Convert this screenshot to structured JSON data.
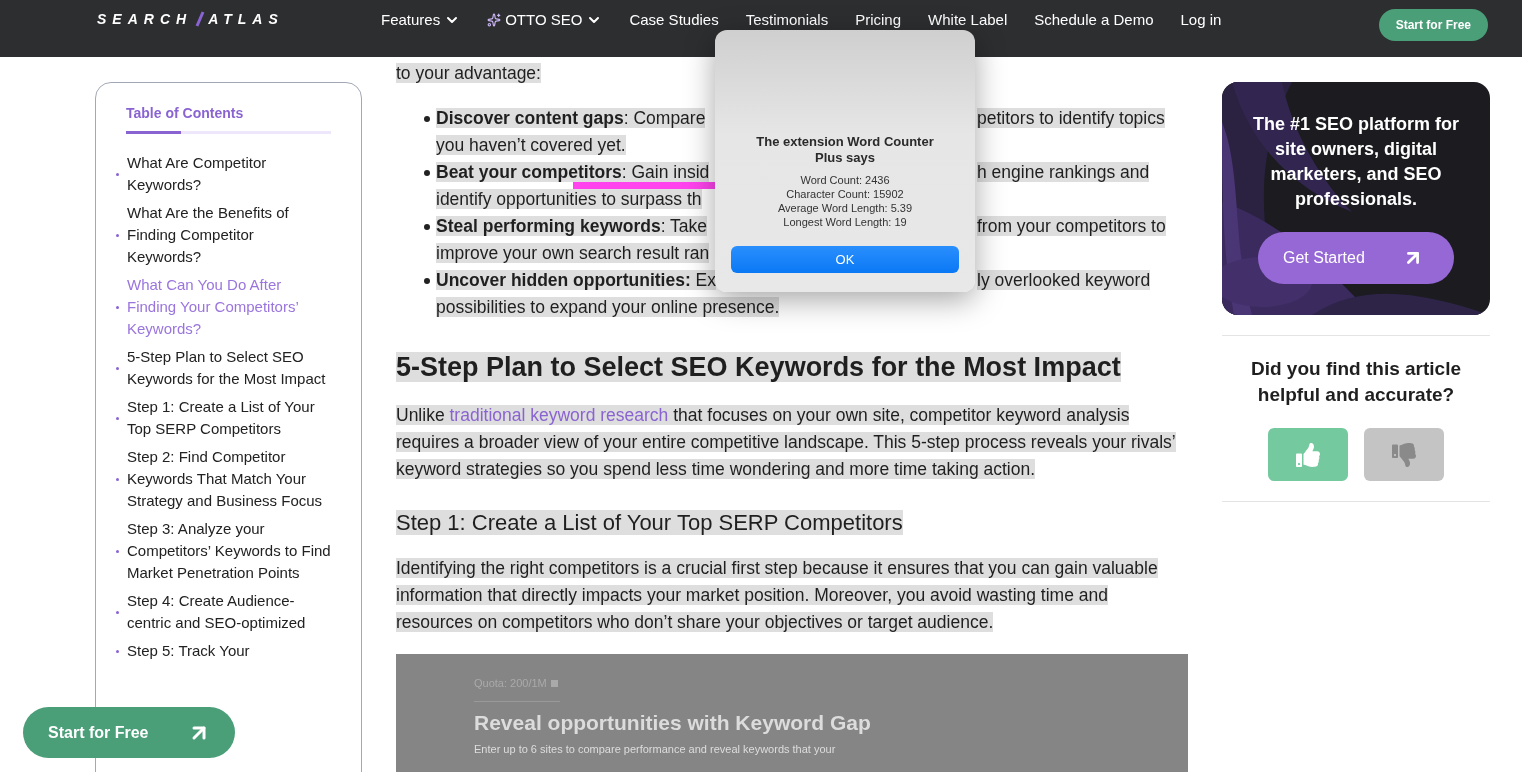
{
  "nav": {
    "logo": {
      "left": "SEARCH",
      "right": "ATLAS"
    },
    "items": [
      {
        "label": "Features",
        "kind": "dropdown"
      },
      {
        "label": "OTTO SEO",
        "kind": "sparkle-dropdown"
      },
      {
        "label": "Case Studies",
        "kind": "link"
      },
      {
        "label": "Testimonials",
        "kind": "link"
      },
      {
        "label": "Pricing",
        "kind": "link"
      },
      {
        "label": "White Label",
        "kind": "link"
      },
      {
        "label": "Schedule a Demo",
        "kind": "link"
      },
      {
        "label": "Log in",
        "kind": "link"
      }
    ],
    "cta": "Start for Free"
  },
  "toc": {
    "title": "Table of Contents",
    "items": [
      {
        "label": "What Are Competitor Keywords?",
        "selected": false
      },
      {
        "label": "What Are the Benefits of Finding Competitor Keywords?",
        "selected": false
      },
      {
        "label": "What Can You Do After Finding Your Competitors’ Keywords?",
        "selected": true
      },
      {
        "label": "5-Step Plan to Select SEO Keywords for the Most Impact",
        "selected": false
      },
      {
        "label": "Step 1: Create a List of Your Top SERP Competitors",
        "selected": false
      },
      {
        "label": "Step 2: Find Competitor Keywords That Match Your Strategy and Business Focus",
        "selected": false
      },
      {
        "label": "Step 3: Analyze your Competitors’ Keywords to Find Market Penetration Points",
        "selected": false
      },
      {
        "label": "Step 4: Create Audience-centric and SEO-optimized",
        "selected": false
      },
      {
        "label": "Step 5: Track Your",
        "selected": false
      }
    ]
  },
  "article": {
    "intro": "to your advantage:",
    "bullets": [
      {
        "lines": [
          {
            "left": "**Discover content gaps**: Compare",
            "right": "petitors to identify topics"
          },
          {
            "left": "you haven’t covered yet."
          }
        ]
      },
      {
        "lines": [
          {
            "left": "**Beat your competitors**: Gain insid",
            "right": "h engine rankings and"
          },
          {
            "left": "identify opportunities to surpass th"
          }
        ]
      },
      {
        "lines": [
          {
            "left": "**Steal performing keywords**: Take",
            "right": "from your competitors to"
          },
          {
            "left": "improve your own search result ran"
          }
        ]
      },
      {
        "lines": [
          {
            "left": "**Uncover hidden opportunities:** Ex",
            "right": "ly overlooked keyword"
          },
          {
            "left": "possibilities to expand your online presence."
          }
        ]
      }
    ],
    "heading": "5-Step Plan to Select SEO Keywords for the Most Impact",
    "paragraph": {
      "before": "Unlike ",
      "link": "traditional keyword research",
      "after": " that focuses on your own site, competitor keyword analysis requires a broader view of your entire competitive landscape. This 5-step process reveals your rivals’ keyword strategies so you spend less time wondering and more time taking action."
    },
    "subheading": "Step 1: Create a List of Your Top SERP Competitors",
    "paragraph2": "Identifying the right competitors is a crucial first step because it ensures that you can gain valuable information that directly impacts your market position. Moreover, you avoid wasting time and resources on competitors who don’t share your objectives or target audience.",
    "screenshot": {
      "quota": "Quota: 200/1M",
      "title": "Reveal opportunities with Keyword Gap",
      "description": "Enter up to 6 sites to compare performance and reveal keywords that your"
    }
  },
  "promo": {
    "text": "The #1 SEO platform for site owners, digital marketers, and SEO professionals.",
    "button": "Get Started"
  },
  "feedback": {
    "question": "Did you find this article helpful and accurate?",
    "buttons": [
      {
        "kind": "up",
        "selected": true
      },
      {
        "kind": "down",
        "selected": false
      }
    ]
  },
  "dialog": {
    "title": "The extension Word Counter Plus says",
    "lines": [
      "Word Count: 2436",
      "Character Count: 15902",
      "Average Word Length: 5.39",
      "Longest Word Length: 19"
    ],
    "button": "OK"
  },
  "floating_button": "Start for Free"
}
